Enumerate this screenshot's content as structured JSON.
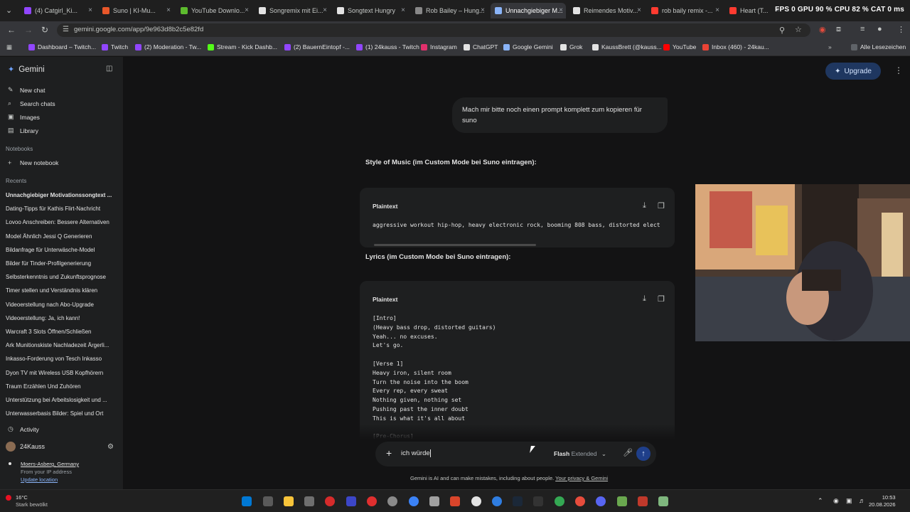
{
  "browser": {
    "tabs": [
      {
        "label": "(4) Catgirl_Ki...",
        "color": "#9146ff"
      },
      {
        "label": "Suno | KI-Mu...",
        "color": "#e8572a"
      },
      {
        "label": "YouTube Downlo...",
        "color": "#5dbb2e"
      },
      {
        "label": "Songremix mit Ei...",
        "color": "#e3e3e3"
      },
      {
        "label": "Songtext Hungry",
        "color": "#e3e3e3"
      },
      {
        "label": "Rob Bailey – Hung...",
        "color": "#888888"
      },
      {
        "label": "Unnachgiebiger M...",
        "color": "#8ab4f8"
      },
      {
        "label": "Reimendes Motiv...",
        "color": "#e3e3e3"
      },
      {
        "label": "rob baily remix -...",
        "color": "#ff3b30"
      },
      {
        "label": "Heart (T...",
        "color": "#ff3b30"
      }
    ],
    "stats": "FPS 0   GPU 90 %   CPU 82 %   CAT 0 ms",
    "url": "gemini.google.com/app/9e963d8b2c5e82fd",
    "bookmarks": [
      {
        "label": "Dashboard – Twitch...",
        "color": "#9146ff"
      },
      {
        "label": "Twitch",
        "color": "#9146ff"
      },
      {
        "label": "(2) Moderation - Tw...",
        "color": "#9146ff"
      },
      {
        "label": "Stream - Kick Dashb...",
        "color": "#53fc18"
      },
      {
        "label": "(2) BauernEintopf -...",
        "color": "#9146ff"
      },
      {
        "label": "(1) 24kauss - Twitch",
        "color": "#9146ff"
      },
      {
        "label": "Instagram",
        "color": "#e1306c"
      },
      {
        "label": "ChatGPT",
        "color": "#e3e3e3"
      },
      {
        "label": "Google Gemini",
        "color": "#8ab4f8"
      },
      {
        "label": "Grok",
        "color": "#e3e3e3"
      },
      {
        "label": "KaussBrett (@kauss...",
        "color": "#e3e3e3"
      },
      {
        "label": "YouTube",
        "color": "#ff0000"
      },
      {
        "label": "Inbox (460) - 24kau...",
        "color": "#ea4335"
      }
    ],
    "all_bookmarks": "Alle Lesezeichen"
  },
  "sidebar": {
    "app_name": "Gemini",
    "nav": [
      {
        "label": "New chat",
        "icon": "edit-icon"
      },
      {
        "label": "Search chats",
        "icon": "search-icon"
      },
      {
        "label": "Images",
        "icon": "image-icon"
      },
      {
        "label": "Library",
        "icon": "library-icon"
      }
    ],
    "notebooks_heading": "Notebooks",
    "new_notebook": "New notebook",
    "recents_heading": "Recents",
    "recents": [
      "Unnachgiebiger Motivationssongtext ...",
      "Dating-Tipps für Kathis Flirt-Nachricht",
      "Lovoo Anschreiben: Bessere Alternativen",
      "Model Ähnlich Jessi Q Generieren",
      "Bildanfrage für Unterwäsche-Model",
      "Bilder für Tinder-Profilgenerierung",
      "Selbsterkenntnis und Zukunftsprognose",
      "Timer stellen und Verständnis klären",
      "Videoerstellung nach Abo-Upgrade",
      "Videoerstellung: Ja, ich kann!",
      "Warcraft 3 Slots Öffnen/Schließen",
      "Ark Munitionskiste Nachladezeit Ärgerli...",
      "Inkasso-Forderung von Tesch Inkasso",
      "Dyon TV mit Wireless USB Kopfhörern",
      "Traum Erzählen Und Zuhören",
      "Unterstützung bei Arbeitslosigkeit und ...",
      "Unterwasserbasis Bilder: Spiel und Ort"
    ],
    "activity": "Activity",
    "user": "24Kauss",
    "location": "Moers-Asberg, Germany",
    "location_sub": "From your IP address",
    "update_location": "Update location"
  },
  "header": {
    "upgrade": "Upgrade"
  },
  "chat": {
    "user_message": "Mach mir bitte noch einen prompt komplett zum kopieren für suno",
    "style_heading": "Style of Music (im Custom Mode bei Suno eintragen):",
    "code_label": "Plaintext",
    "style_code": "aggressive workout hip-hop, heavy electronic rock, booming 808 bass, distorted elect",
    "lyrics_heading": "Lyrics (im Custom Mode bei Suno eintragen):",
    "lyrics_code": "[Intro]\n(Heavy bass drop, distorted guitars)\nYeah... no excuses.\nLet's go.\n\n[Verse 1]\nHeavy iron, silent room\nTurn the noise into the boom\nEvery rep, every sweat\nNothing given, nothing set\nPushing past the inner doubt\nThis is what it's all about\n\n[Pre-Chorus]"
  },
  "composer": {
    "input_value": "ich würde",
    "model": "Flash",
    "model_mode": "Extended",
    "disclaimer": "Gemini is AI and can make mistakes, including about people.",
    "privacy_link": "Your privacy & Gemini"
  },
  "taskbar": {
    "temp": "16°C",
    "weather": "Stark bewölkt",
    "time": "10:53",
    "date": "20.08.2026"
  }
}
